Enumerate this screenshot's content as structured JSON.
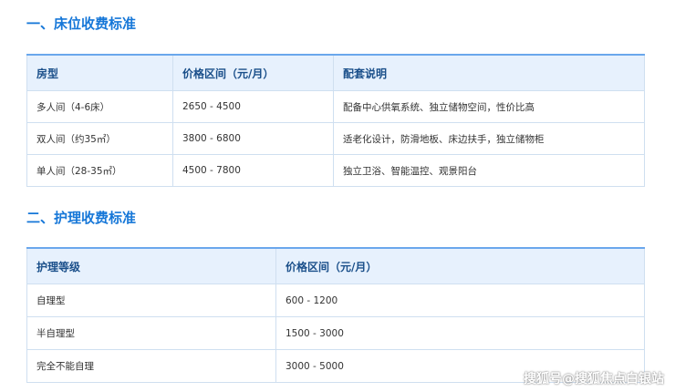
{
  "section1": {
    "title": "一、床位收费标准",
    "headers": [
      "房型",
      "价格区间（元/月）",
      "配套说明"
    ],
    "rows": [
      [
        "多人间（4-6床）",
        "2650 - 4500",
        "配备中心供氧系统、独立储物空间，性价比高"
      ],
      [
        "双人间（约35㎡）",
        "3800 - 6800",
        "适老化设计，防滑地板、床边扶手，独立储物柜"
      ],
      [
        "单人间（28-35㎡）",
        "4500 - 7800",
        "独立卫浴、智能温控、观景阳台"
      ]
    ]
  },
  "section2": {
    "title": "二、护理收费标准",
    "headers": [
      "护理等级",
      "价格区间（元/月）"
    ],
    "rows": [
      [
        "自理型",
        "600 - 1200"
      ],
      [
        "半自理型",
        "1500 - 3000"
      ],
      [
        "完全不能自理",
        "3000 - 5000"
      ]
    ]
  },
  "watermark": "搜狐号@搜狐焦点白银站"
}
